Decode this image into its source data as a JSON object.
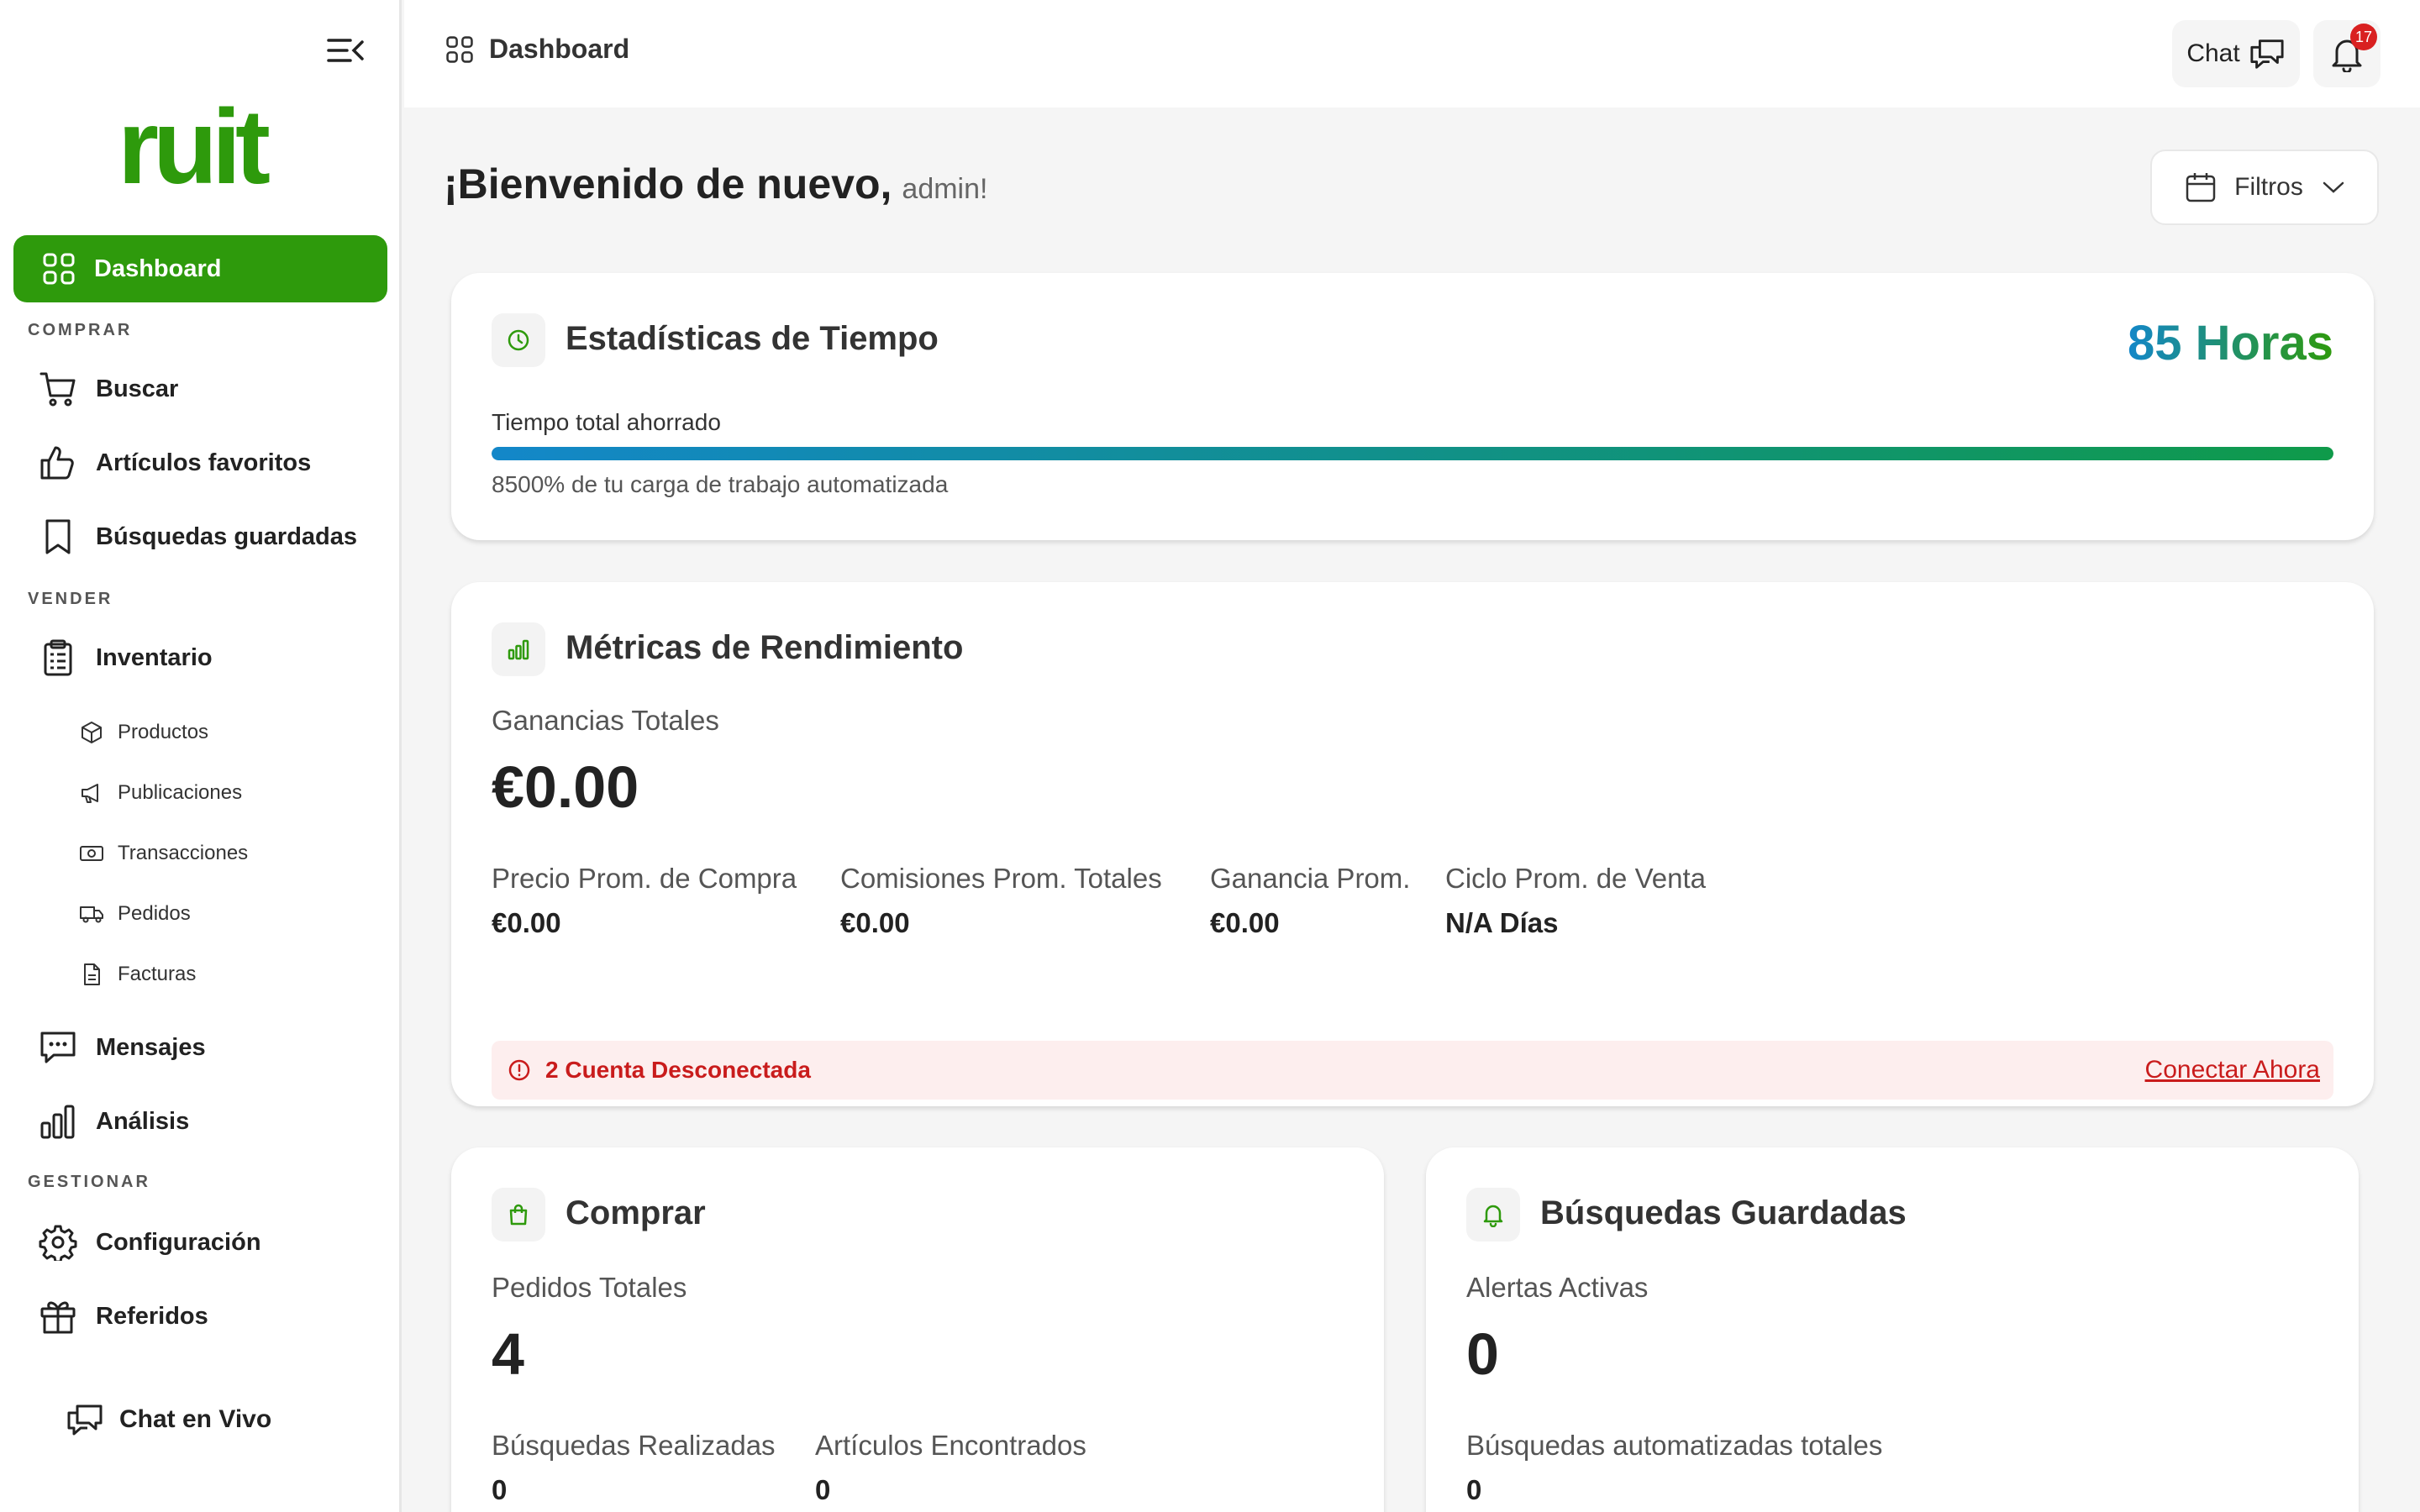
{
  "brand": {
    "logo": "ruit",
    "color": "#2e9a0c"
  },
  "sidebar": {
    "active": {
      "label": "Dashboard",
      "icon": "grid-icon"
    },
    "sections": {
      "buy": "COMPRAR",
      "sell": "VENDER",
      "manage": "GESTIONAR"
    },
    "items": [
      {
        "label": "Buscar",
        "icon": "cart-icon"
      },
      {
        "label": "Artículos favoritos",
        "icon": "thumbs-up-icon"
      },
      {
        "label": "Búsquedas guardadas",
        "icon": "bookmark-icon"
      },
      {
        "label": "Inventario",
        "icon": "clipboard-icon"
      },
      {
        "label": "Mensajes",
        "icon": "message-icon"
      },
      {
        "label": "Análisis",
        "icon": "bar-chart-icon"
      },
      {
        "label": "Configuración",
        "icon": "gear-icon"
      },
      {
        "label": "Referidos",
        "icon": "gift-icon"
      }
    ],
    "sub_items": [
      {
        "label": "Productos",
        "icon": "box-icon"
      },
      {
        "label": "Publicaciones",
        "icon": "megaphone-icon"
      },
      {
        "label": "Transacciones",
        "icon": "banknote-icon"
      },
      {
        "label": "Pedidos",
        "icon": "truck-icon"
      },
      {
        "label": "Facturas",
        "icon": "file-icon"
      }
    ],
    "live_chat": "Chat en Vivo"
  },
  "header": {
    "breadcrumb": "Dashboard",
    "chat_label": "Chat",
    "notification_count": "17"
  },
  "main": {
    "welcome": "¡Bienvenido de nuevo,",
    "user": "admin!",
    "filters_label": "Filtros"
  },
  "time_stats": {
    "title": "Estadísticas de Tiempo",
    "hours": "85 Horas",
    "saved_label": "Tiempo total ahorrado",
    "progress_percent": 100,
    "automation_text": "8500% de tu carga de trabajo automatizada"
  },
  "performance": {
    "title": "Métricas de Rendimiento",
    "total_label": "Ganancias Totales",
    "total_value": "€0.00",
    "metrics": [
      {
        "label": "Precio Prom. de Compra",
        "value": "€0.00"
      },
      {
        "label": "Comisiones Prom. Totales",
        "value": "€0.00"
      },
      {
        "label": "Ganancia Prom.",
        "value": "€0.00"
      },
      {
        "label": "Ciclo Prom. de Venta",
        "value": "N/A Días"
      }
    ],
    "alert_text": "2 Cuenta Desconectada",
    "alert_link": "Conectar Ahora"
  },
  "buy_card": {
    "title": "Comprar",
    "orders_label": "Pedidos Totales",
    "orders_value": "4",
    "searches_label": "Búsquedas Realizadas",
    "searches_value": "0",
    "found_label": "Artículos Encontrados",
    "found_value": "0"
  },
  "saved_card": {
    "title": "Búsquedas Guardadas",
    "alerts_label": "Alertas Activas",
    "alerts_value": "0",
    "auto_label": "Búsquedas automatizadas totales",
    "auto_value": "0"
  }
}
